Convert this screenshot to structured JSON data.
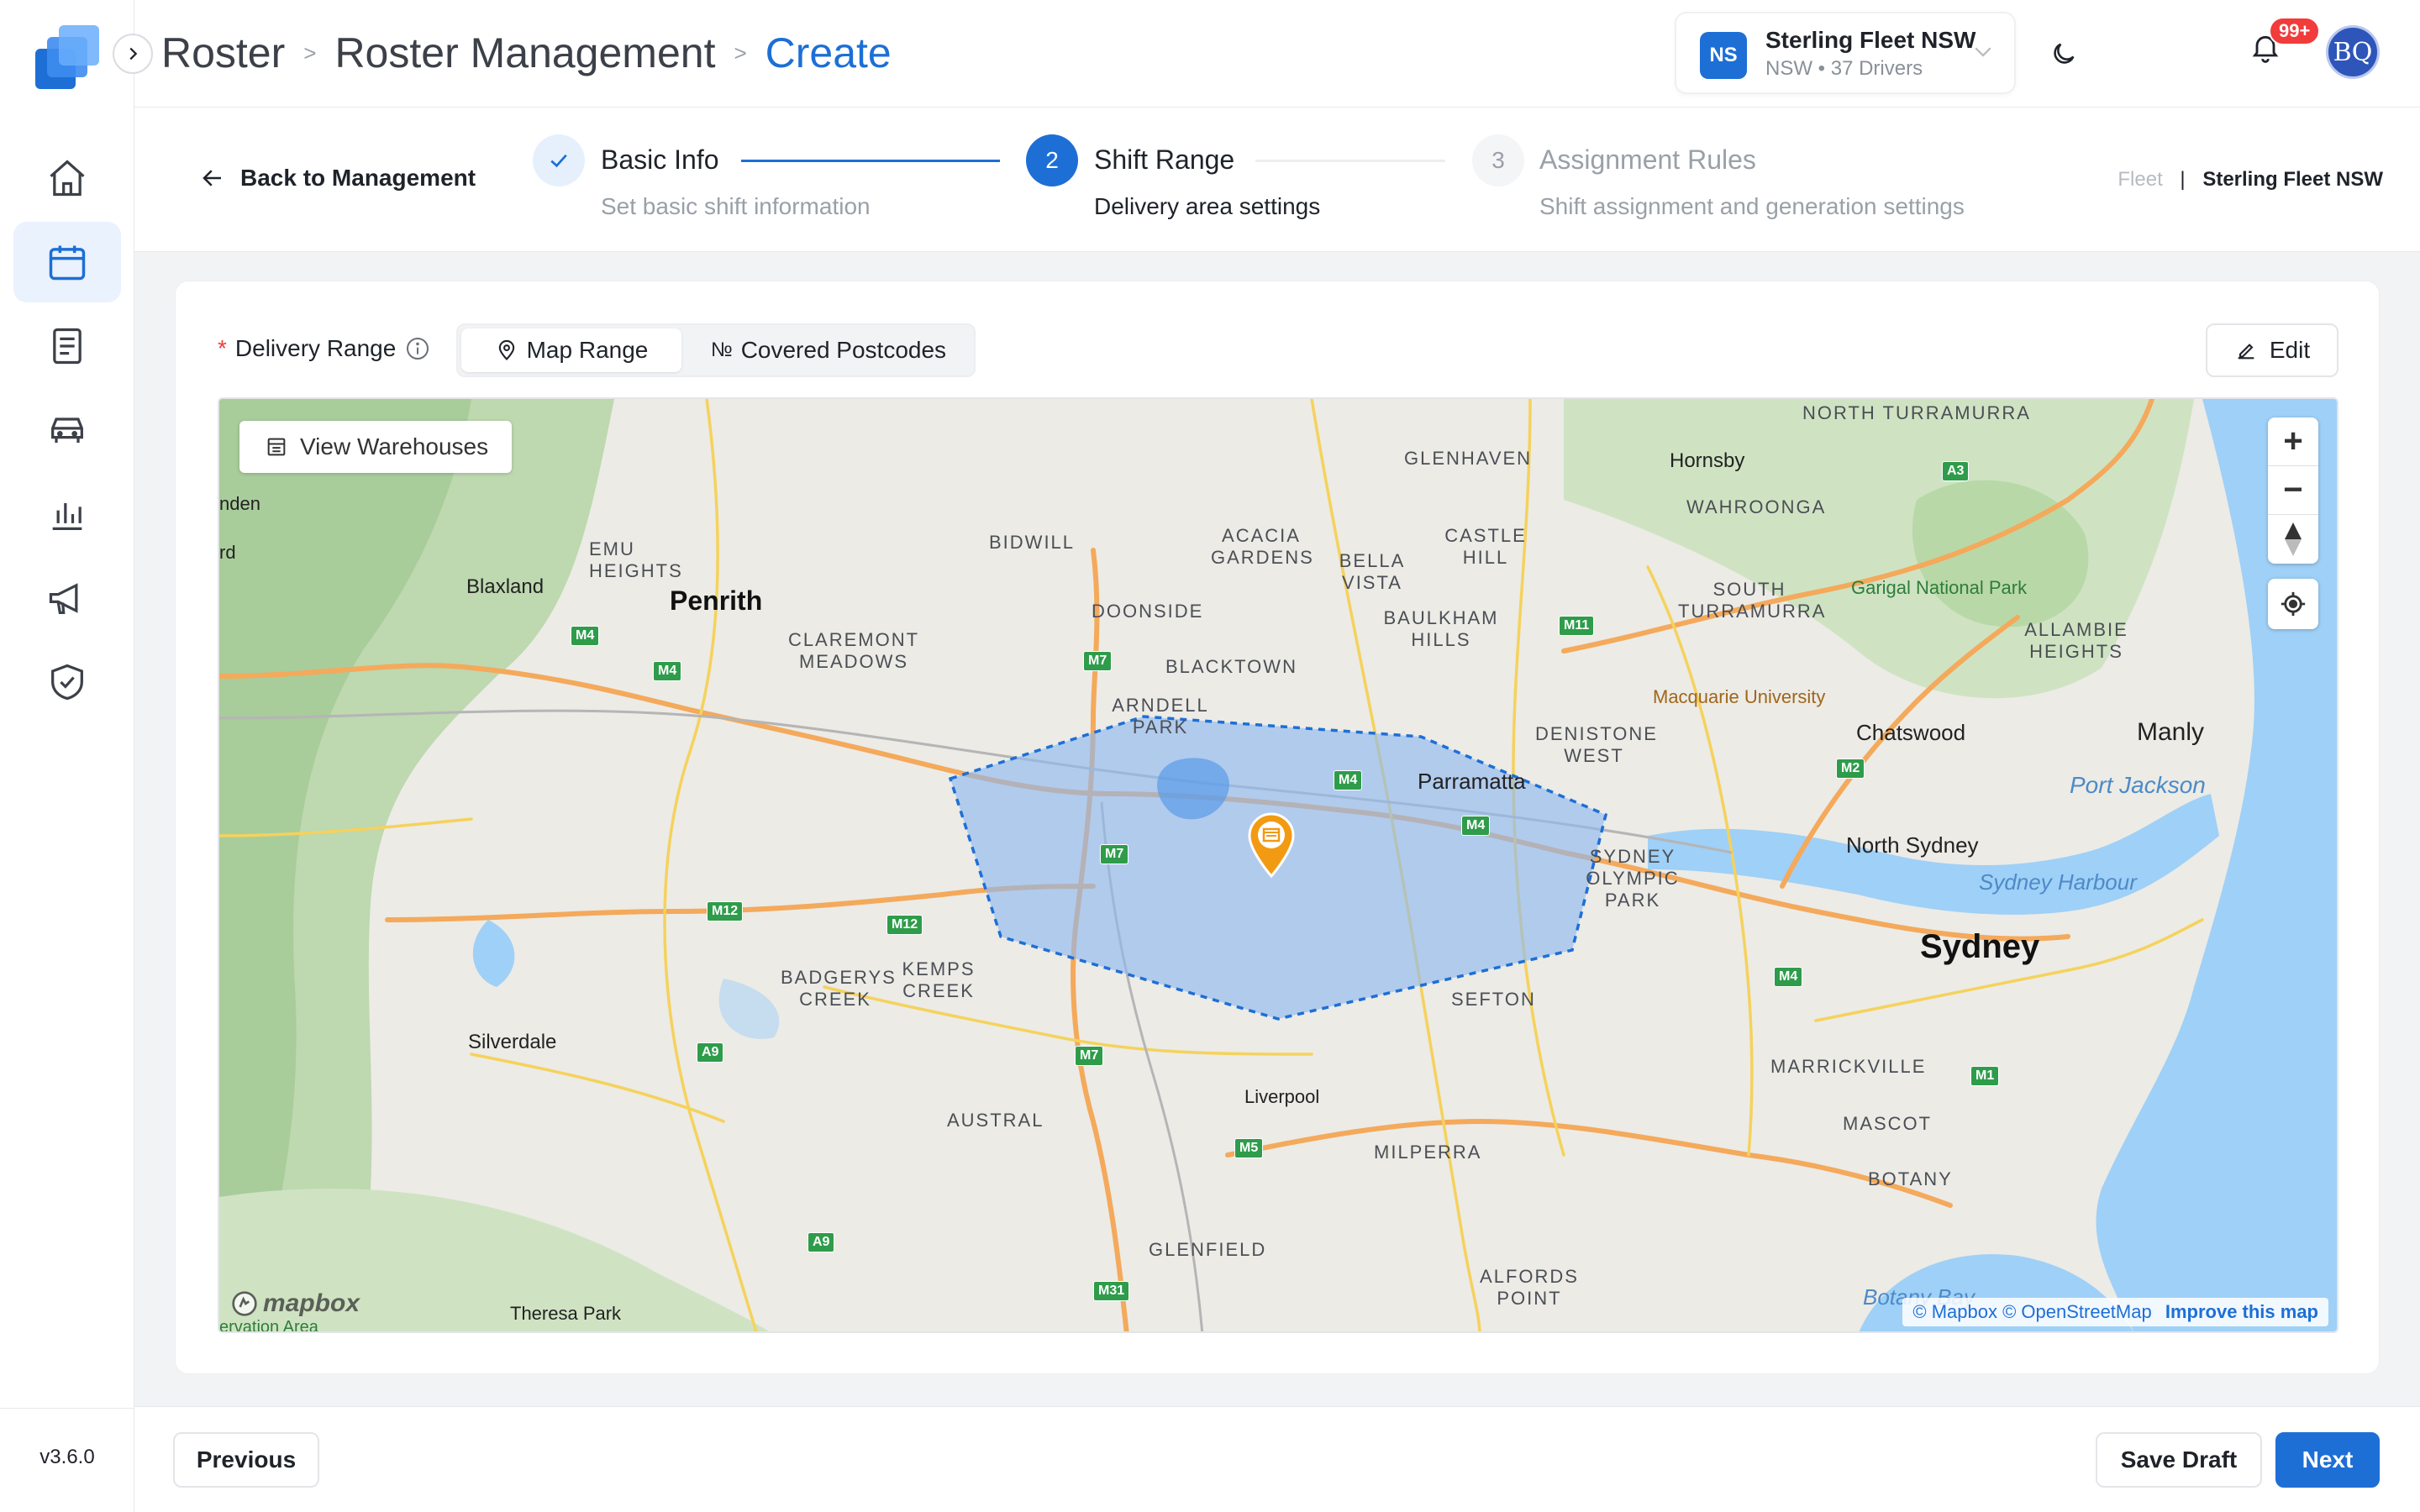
{
  "app": {
    "version": "v3.6.0"
  },
  "breadcrumb": {
    "items": [
      "Roster",
      "Roster Management"
    ],
    "current": "Create",
    "separator": ">"
  },
  "fleet": {
    "initials": "NS",
    "name": "Sterling Fleet NSW",
    "meta": "NSW • 37 Drivers"
  },
  "notifications": {
    "badge": "99+"
  },
  "user": {
    "initials": "BQ"
  },
  "stepper": {
    "back_label": "Back to Management",
    "steps": [
      {
        "index": "1",
        "title": "Basic Info",
        "subtitle": "Set basic shift information",
        "state": "done"
      },
      {
        "index": "2",
        "title": "Shift Range",
        "subtitle": "Delivery area settings",
        "state": "active"
      },
      {
        "index": "3",
        "title": "Assignment Rules",
        "subtitle": "Shift assignment and generation settings",
        "state": "pending"
      }
    ],
    "fleet_caption": "Fleet",
    "fleet_divider": "|",
    "fleet_value": "Sterling Fleet NSW"
  },
  "form": {
    "required_mark": "*",
    "range_label": "Delivery Range",
    "tabs": [
      {
        "label": "Map Range",
        "icon": "location-pin-icon",
        "selected": true
      },
      {
        "label": "Covered Postcodes",
        "icon": "numero-icon",
        "selected": false
      }
    ],
    "numero_glyph": "№",
    "edit_label": "Edit"
  },
  "map": {
    "view_warehouses": "View Warehouses",
    "zoom_in": "+",
    "zoom_out": "−",
    "attribution": "© Mapbox © OpenStreetMap",
    "improve": "Improve this map",
    "logo_text": "mapbox",
    "labels": {
      "north_turramurra": "North Turramurra",
      "glenhaven": "Glenhaven",
      "hornsby": "Hornsby",
      "wahroonga": "Wahroonga",
      "emu_heights": "Emu Heights",
      "blaxland": "Blaxland",
      "penrith": "Penrith",
      "bidwill": "Bidwill",
      "acacia_gardens": "Acacia Gardens",
      "bella_vista": "Bella Vista",
      "castle_hill": "Castle Hill",
      "south_turramurra": "South Turramurra",
      "garigal": "Garigal National Park",
      "allambie": "Allambie Heights",
      "claremont_meadows": "Claremont Meadows",
      "doonside": "Doonside",
      "baulkham_hills": "Baulkham Hills",
      "blacktown": "Blacktown",
      "macquarie": "Macquarie University",
      "arndell_park": "Arndell Park",
      "denistone_west": "Denistone West",
      "chatswood": "Chatswood",
      "manly": "Manly",
      "parramatta": "Parramatta",
      "port_jackson": "Port Jackson",
      "sydney_olympic": "Sydney Olympic Park",
      "north_sydney": "North Sydney",
      "sydney_harbour": "Sydney Harbour",
      "sydney": "Sydney",
      "badgerys_creek": "Badgerys Creek",
      "kemps_creek": "Kemps Creek",
      "sefton": "Sefton",
      "silverdale": "Silverdale",
      "marrickville": "Marrickville",
      "austral": "Austral",
      "mascot": "Mascot",
      "liverpool": "Liverpool",
      "milperra": "Milperra",
      "botany": "Botany",
      "glenfield": "Glenfield",
      "alfords_point": "Alfords Point",
      "botany_bay": "Botany Bay",
      "theresa_park": "Theresa Park",
      "nden": "nden",
      "rd": "rd",
      "ervation": "ervation Area"
    },
    "shields": [
      "M4",
      "M4",
      "M7",
      "M7",
      "M7",
      "M4",
      "M4",
      "M12",
      "M12",
      "A9",
      "A9",
      "M5",
      "M31",
      "M11",
      "M2",
      "M4",
      "M1",
      "A3"
    ]
  },
  "footer": {
    "previous": "Previous",
    "save_draft": "Save Draft",
    "next": "Next"
  },
  "colors": {
    "accent": "#1d6fd6",
    "polygon_fill": "#8db8f0",
    "pin": "#f29a12",
    "badge": "#f23b3b"
  }
}
